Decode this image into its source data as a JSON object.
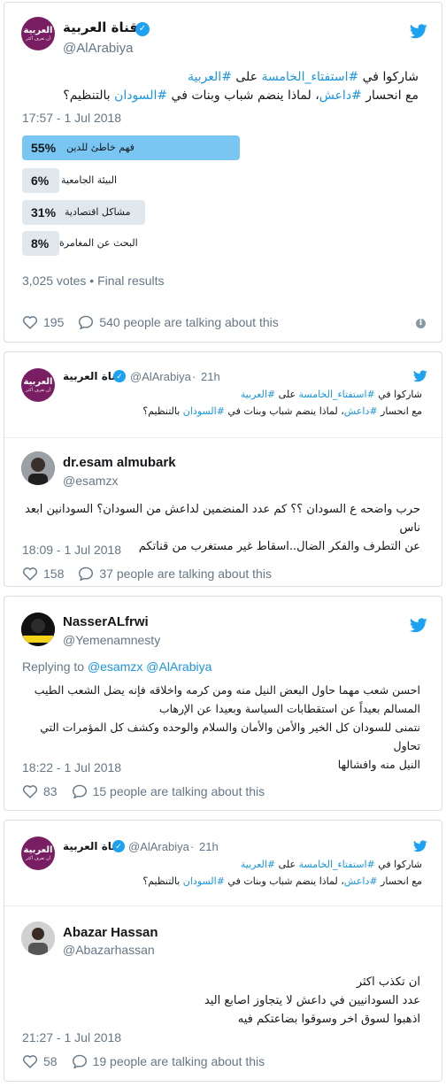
{
  "colors": {
    "brand": "#7a1e64",
    "link": "#1b95e0",
    "poll_winner": "#79c6f2",
    "poll_bar": "#e1e8ed",
    "muted": "#657786"
  },
  "arabiya_avatar": {
    "big": "العربية",
    "small": "أن تعرف أكثر"
  },
  "tweet1": {
    "name": "قناة العربية",
    "handle": "@AlArabiya",
    "line1_pre": "شاركوا في ",
    "line1_tag1": "#استفتاء_الخامسة",
    "line1_mid": " على ",
    "line1_tag2": "#العربية",
    "line2_pre": "مع انحسار ",
    "line2_tag1": "#داعش",
    "line2_mid": "، لماذا ينضم شباب وبنات في ",
    "line2_tag2": "#السودان",
    "line2_post": " بالتنظيم؟",
    "timestamp": "17:57 - 1 Jul 2018",
    "poll": [
      {
        "pct": "55%",
        "label": "فهم خاطئ للدين",
        "value": 0.55,
        "winner": true
      },
      {
        "pct": "6%",
        "label": "البيئة الجامعية",
        "value": 0.06,
        "winner": false
      },
      {
        "pct": "31%",
        "label": "مشاكل اقتصادية",
        "value": 0.31,
        "winner": false
      },
      {
        "pct": "8%",
        "label": "البحث عن المغامرة",
        "value": 0.08,
        "winner": false
      }
    ],
    "poll_summary": "3,025 votes • Final results",
    "likes": "195",
    "talking": "540 people are talking about this"
  },
  "card2": {
    "quoted": {
      "name": "قناة العربية",
      "handle": "@AlArabiya",
      "time": "21h"
    },
    "reply": {
      "name": "dr.esam almubark",
      "handle": "@esamzx",
      "line1": "حرب واضحه ع السودان ؟؟ كم عدد المنضمين لداعش من السودان؟ السودانين ابعد ناس",
      "line2": "عن التطرف والفكر الضال..اسقاط غير مستغرب من قناتكم",
      "timestamp": "18:09 - 1 Jul 2018",
      "likes": "158",
      "talking": "37 people are talking about this"
    }
  },
  "card3": {
    "name": "NasserALfrwi",
    "handle": "@Yemenamnesty",
    "replying_prefix": "Replying to ",
    "replying_to": "@esamzx @AlArabiya",
    "line1": "احسن شعب مهما حاول البعض النيل منه ومن كرمه واخلاقه فإنه يضل الشعب الطيب",
    "line2": "المسالم بعيداً عن استقطابات السياسة وبعيدا عن الإرهاب",
    "line3": "نتمنى للسودان كل الخير والأمن والأمان والسلام والوحده وكشف كل المؤمرات التي تحاول",
    "line4": "النيل منه وافشالها",
    "timestamp": "18:22 - 1 Jul 2018",
    "likes": "83",
    "talking": "15 people are talking about this"
  },
  "card4": {
    "quoted": {
      "name": "قناة العربية",
      "handle": "@AlArabiya",
      "time": "21h"
    },
    "reply": {
      "name": "Abazar Hassan",
      "handle": "@Abazarhassan",
      "line1": "ان تكذب اكثر",
      "line2": "عدد السودانيين في داعش لا يتجاوز اصابع اليد",
      "line3": "اذهبوا لسوق اخر وسوقوا بضاعتكم فيه",
      "timestamp": "21:27 - 1 Jul 2018",
      "likes": "58",
      "talking": "19 people are talking about this"
    }
  }
}
